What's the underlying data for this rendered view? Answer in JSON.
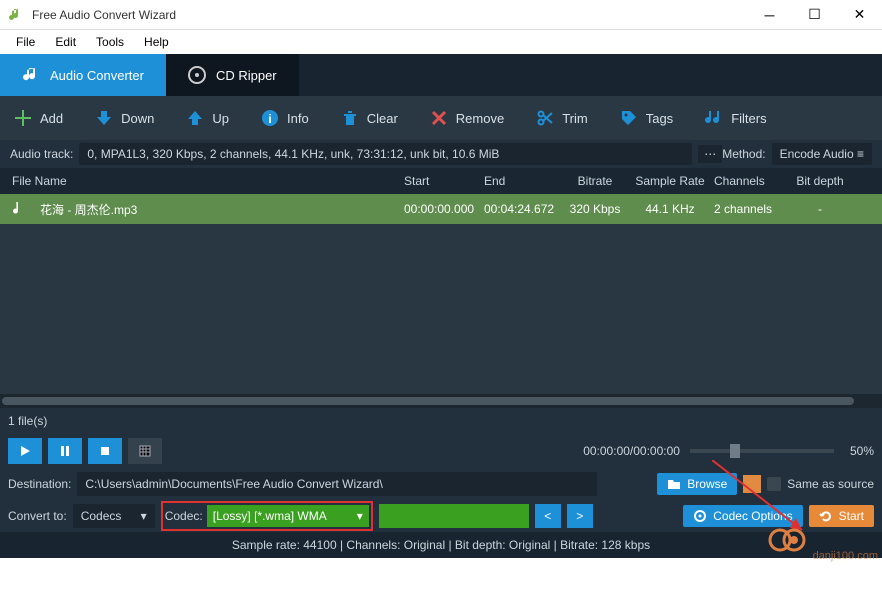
{
  "app": {
    "title": "Free Audio Convert Wizard"
  },
  "menu": [
    "File",
    "Edit",
    "Tools",
    "Help"
  ],
  "tabs": {
    "converter": "Audio Converter",
    "cdripper": "CD Ripper"
  },
  "toolbar": {
    "add": "Add",
    "down": "Down",
    "up": "Up",
    "info": "Info",
    "clear": "Clear",
    "remove": "Remove",
    "trim": "Trim",
    "tags": "Tags",
    "filters": "Filters"
  },
  "info_row": {
    "label": "Audio track:",
    "value": "0, MPA1L3, 320 Kbps, 2 channels, 44.1 KHz, unk, 73:31:12, unk bit, 10.6 MiB",
    "method_label": "Method:",
    "method_value": "Encode Audio"
  },
  "columns": {
    "name": "File Name",
    "start": "Start",
    "end": "End",
    "bitrate": "Bitrate",
    "sr": "Sample Rate",
    "ch": "Channels",
    "bd": "Bit depth"
  },
  "rows": [
    {
      "name": "花海 - 周杰伦.mp3",
      "start": "00:00:00.000",
      "end": "00:04:24.672",
      "bitrate": "320 Kbps",
      "sr": "44.1 KHz",
      "ch": "2 channels",
      "bd": "-"
    }
  ],
  "file_count": "1 file(s)",
  "playback": {
    "time": "00:00:00/00:00:00",
    "pct": "50%"
  },
  "dest": {
    "label": "Destination:",
    "value": "C:\\Users\\admin\\Documents\\Free Audio Convert Wizard\\",
    "browse": "Browse",
    "same": "Same as source"
  },
  "convert": {
    "label": "Convert to:",
    "codecs": "Codecs",
    "codec_label": "Codec:",
    "codec_value": "[Lossy] [*.wma] WMA",
    "lt": "<",
    "gt": ">",
    "options": "Codec Options",
    "start": "Start"
  },
  "status": "Sample rate: 44100 | Channels: Original | Bit depth: Original | Bitrate: 128 kbps",
  "watermark": "danji100.com"
}
